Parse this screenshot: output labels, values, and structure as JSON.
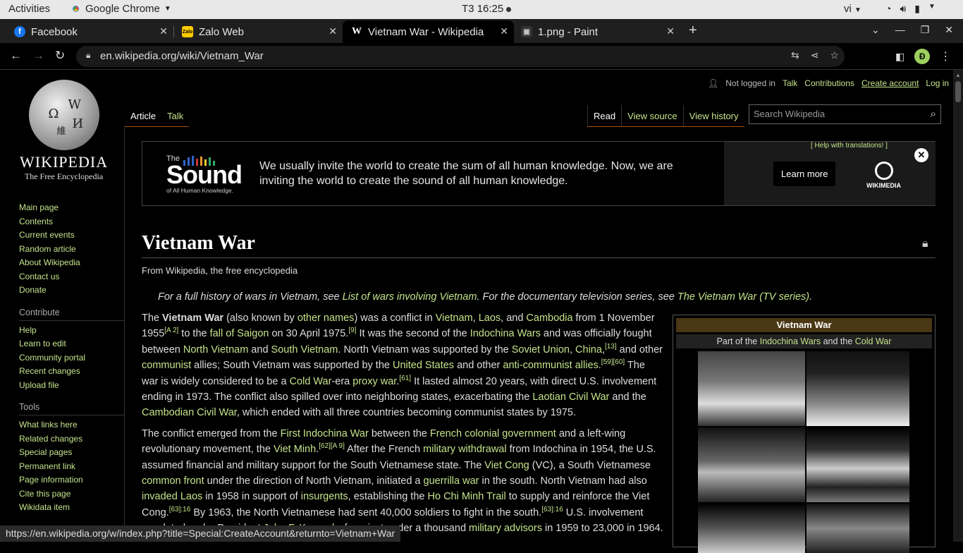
{
  "os": {
    "activities": "Activities",
    "app_name": "Google Chrome",
    "clock": "T3 16:25",
    "lang": "vi"
  },
  "browser": {
    "tabs": [
      {
        "title": "Facebook",
        "favicon": "facebook-icon"
      },
      {
        "title": "Zalo Web",
        "favicon": "zalo-icon"
      },
      {
        "title": "Vietnam War - Wikipedia",
        "favicon": "wikipedia-icon"
      },
      {
        "title": "1.png - Paint",
        "favicon": "paint-icon"
      }
    ],
    "url": "en.wikipedia.org/wiki/Vietnam_War",
    "profile_initial": "Đ",
    "status_url": "https://en.wikipedia.org/w/index.php?title=Special:CreateAccount&returnto=Vietnam+War"
  },
  "wiki": {
    "logo_wordmark": "WIKIPEDIA",
    "logo_tagline": "The Free Encyclopedia",
    "user": {
      "not_logged_in": "Not logged in",
      "talk": "Talk",
      "contributions": "Contributions",
      "create_account": "Create account",
      "log_in": "Log in"
    },
    "tabs_left": [
      "Article",
      "Talk"
    ],
    "tabs_right": [
      "Read",
      "View source",
      "View history"
    ],
    "search_placeholder": "Search Wikipedia",
    "nav_main": [
      "Main page",
      "Contents",
      "Current events",
      "Random article",
      "About Wikipedia",
      "Contact us",
      "Donate"
    ],
    "contribute_header": "Contribute",
    "nav_contribute": [
      "Help",
      "Learn to edit",
      "Community portal",
      "Recent changes",
      "Upload file"
    ],
    "tools_header": "Tools",
    "nav_tools": [
      "What links here",
      "Related changes",
      "Special pages",
      "Permanent link",
      "Page information",
      "Cite this page",
      "Wikidata item"
    ],
    "banner": {
      "logo_the": "The",
      "logo_sound": "Sound",
      "logo_sub": "of All Human Knowledge.",
      "message": "We usually invite the world to create the sum of all human knowledge. Now, we are inviting the world to create the sound of all human knowledge.",
      "help_link": "[ Help with translations! ]",
      "learn_more": "Learn more",
      "wikimedia": "WIKIMEDIA"
    },
    "title": "Vietnam War",
    "from": "From Wikipedia, the free encyclopedia",
    "hatnote": {
      "a": "For a full history of wars in Vietnam, see ",
      "link1": "List of wars involving Vietnam",
      "b": ". For the documentary television series, see ",
      "link2": "The Vietnam War (TV series)",
      "c": "."
    },
    "infobox": {
      "title": "Vietnam War",
      "part_of_a": "Part of the ",
      "part_link1": "Indochina Wars",
      "part_and": " and the ",
      "part_link2": "Cold War"
    }
  },
  "colors": {
    "link": "#c5e38b",
    "infobox_header": "#4a3713",
    "tab_underline": "#a55000"
  }
}
